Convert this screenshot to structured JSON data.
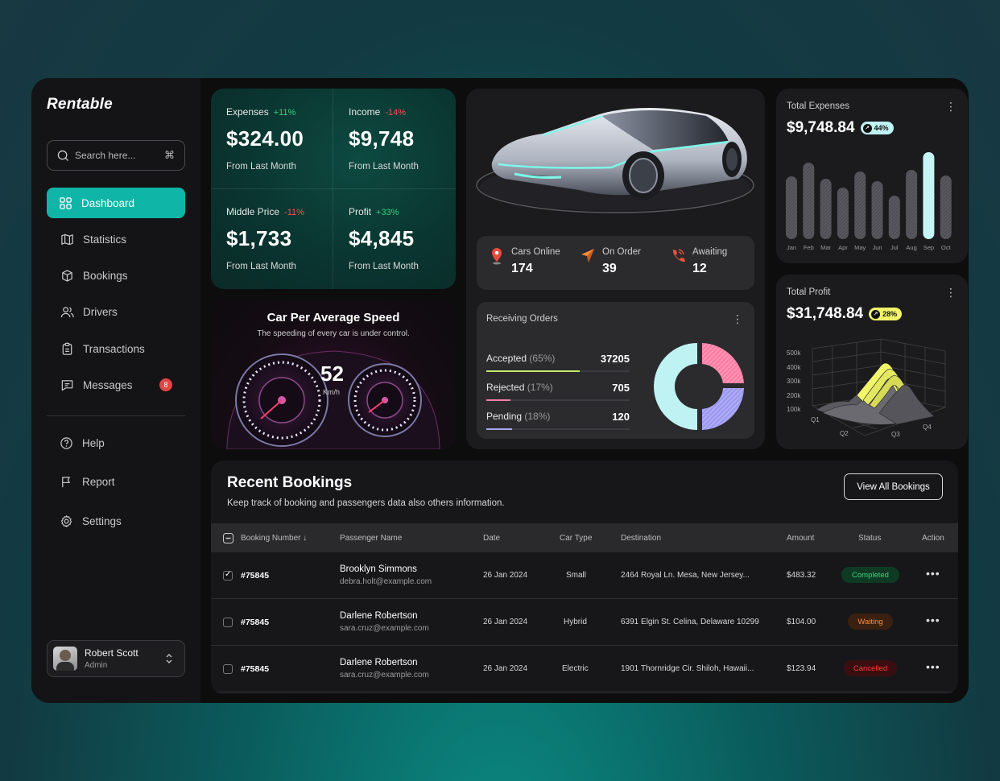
{
  "app": {
    "name": "Rentable"
  },
  "search": {
    "placeholder": "Search here...",
    "shortcut": "⌘"
  },
  "nav": {
    "items": [
      {
        "label": "Dashboard"
      },
      {
        "label": "Statistics"
      },
      {
        "label": "Bookings"
      },
      {
        "label": "Drivers"
      },
      {
        "label": "Transactions"
      },
      {
        "label": "Messages",
        "badge": "8"
      }
    ],
    "secondary": [
      {
        "label": "Help"
      },
      {
        "label": "Report"
      },
      {
        "label": "Settings"
      }
    ]
  },
  "user": {
    "name": "Robert Scott",
    "role": "Admin"
  },
  "stats": [
    {
      "label": "Expenses",
      "change": "+11%",
      "value": "$324.00",
      "sub": "From Last Month"
    },
    {
      "label": "Income",
      "change": "-14%",
      "value": "$9,748",
      "sub": "From Last Month"
    },
    {
      "label": "Middle Price",
      "change": "-11%",
      "value": "$1,733",
      "sub": "From Last Month"
    },
    {
      "label": "Profit",
      "change": "+33%",
      "value": "$4,845",
      "sub": "From Last Month"
    }
  ],
  "speed": {
    "title": "Car Per Average Speed",
    "subtitle": "The speeding of every car is under control.",
    "value": "52",
    "unit": "Km/h"
  },
  "cars": {
    "online_label": "Cars Online",
    "online": "174",
    "order_label": "On Order",
    "order": "39",
    "awaiting_label": "Awaiting",
    "awaiting": "12"
  },
  "orders": {
    "title": "Receiving Orders",
    "rows": [
      {
        "name": "Accepted",
        "pct": "(65%)",
        "value": "37205",
        "fraction": 0.65,
        "color": "#c8e86a"
      },
      {
        "name": "Rejected",
        "pct": "(17%)",
        "value": "705",
        "fraction": 0.17,
        "color": "#ff7ea5"
      },
      {
        "name": "Pending",
        "pct": "(18%)",
        "value": "120",
        "fraction": 0.18,
        "color": "#a9a7f0"
      }
    ]
  },
  "total_expenses": {
    "title": "Total Expenses",
    "value": "$9,748.84",
    "badge": "44%",
    "chart_data": {
      "type": "bar",
      "categories": [
        "Jan",
        "Feb",
        "Mar",
        "Apr",
        "May",
        "Jun",
        "Jul",
        "Aug",
        "Sep",
        "Oct"
      ],
      "values": [
        78,
        95,
        75,
        64,
        84,
        72,
        54,
        86,
        108,
        79
      ],
      "highlight": "Sep"
    }
  },
  "total_profit": {
    "title": "Total Profit",
    "value": "$31,748.84",
    "badge": "28%",
    "chart_data": {
      "type": "area",
      "ylabels": [
        "500k",
        "400k",
        "300k",
        "200k",
        "100k"
      ],
      "xlabels": [
        "Q1",
        "Q2",
        "Q3",
        "Q4"
      ]
    }
  },
  "bookings": {
    "title": "Recent Bookings",
    "subtitle": "Keep track of booking and passengers data also others information.",
    "button": "View All Bookings",
    "columns": [
      "Booking Number",
      "Passenger Name",
      "Date",
      "Car Type",
      "Destination",
      "Amount",
      "Status",
      "Action"
    ],
    "rows": [
      {
        "number": "#75845",
        "name": "Brooklyn Simmons",
        "email": "debra.holt@example.com",
        "date": "26 Jan 2024",
        "car": "Small",
        "dest": "2464 Royal Ln. Mesa, New Jersey...",
        "amount": "$483.32",
        "status": "Completed",
        "checked": true
      },
      {
        "number": "#75845",
        "name": "Darlene Robertson",
        "email": "sara.cruz@example.com",
        "date": "26 Jan 2024",
        "car": "Hybrid",
        "dest": "6391 Elgin St. Celina, Delaware 10299",
        "amount": "$104.00",
        "status": "Waiting",
        "checked": false
      },
      {
        "number": "#75845",
        "name": "Darlene Robertson",
        "email": "sara.cruz@example.com",
        "date": "26 Jan 2024",
        "car": "Electric",
        "dest": "1901 Thornridge Cir. Shiloh, Hawaii...",
        "amount": "$123.94",
        "status": "Cancelled",
        "checked": false
      }
    ]
  },
  "colors": {
    "accent": "#0fb5a6",
    "up": "#37d07a",
    "down": "#ff4d4d"
  }
}
